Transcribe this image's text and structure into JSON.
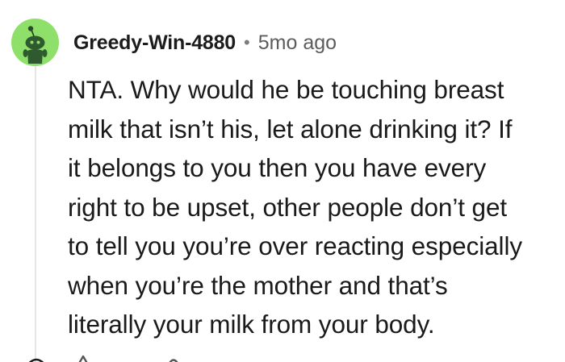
{
  "comment": {
    "username": "Greedy-Win-4880",
    "separator": "•",
    "time_ago": "5mo ago",
    "body_lines": [
      "NTA. Why would he be touching breast",
      "milk that isn’t his, let alone drinking it? If",
      "it belongs to you then you have every",
      "right to be upset, other people don’t get",
      "to tell you you’re over reacting especially",
      "when you’re the mother and that’s",
      "literally your milk from your body."
    ],
    "avatar_icon": "snoo-avatar-icon",
    "avatar_color": "#8ee06a"
  },
  "action_bar": {
    "icons": [
      "collapse-icon",
      "upvote-icon",
      "downvote-icon"
    ]
  }
}
